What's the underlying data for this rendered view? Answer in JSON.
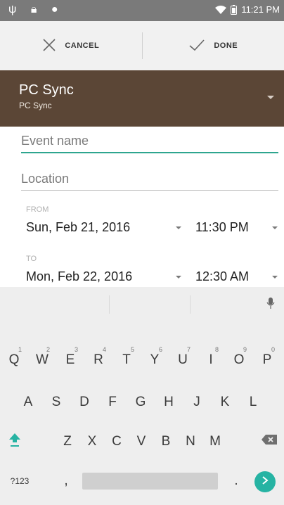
{
  "status_bar": {
    "time": "11:21 PM"
  },
  "toolbar": {
    "cancel_label": "CANCEL",
    "done_label": "DONE"
  },
  "calendar": {
    "name": "PC Sync",
    "account": "PC Sync"
  },
  "form": {
    "event_placeholder": "Event name",
    "location_placeholder": "Location",
    "from_label": "FROM",
    "from_date": "Sun, Feb 21, 2016",
    "from_time": "11:30 PM",
    "to_label": "TO",
    "to_date": "Mon, Feb 22, 2016",
    "to_time": "12:30 AM"
  },
  "keyboard": {
    "row1": [
      "Q",
      "W",
      "E",
      "R",
      "T",
      "Y",
      "U",
      "I",
      "O",
      "P"
    ],
    "row1_digits": [
      "1",
      "2",
      "3",
      "4",
      "5",
      "6",
      "7",
      "8",
      "9",
      "0"
    ],
    "row2": [
      "A",
      "S",
      "D",
      "F",
      "G",
      "H",
      "J",
      "K",
      "L"
    ],
    "row3": [
      "Z",
      "X",
      "C",
      "V",
      "B",
      "N",
      "M"
    ],
    "sym_key": "?123",
    "comma_key": ",",
    "period_key": "."
  },
  "colors": {
    "accent": "#26b3a3",
    "calendar_bg": "#5b4636",
    "underline": "#2ea58f"
  }
}
